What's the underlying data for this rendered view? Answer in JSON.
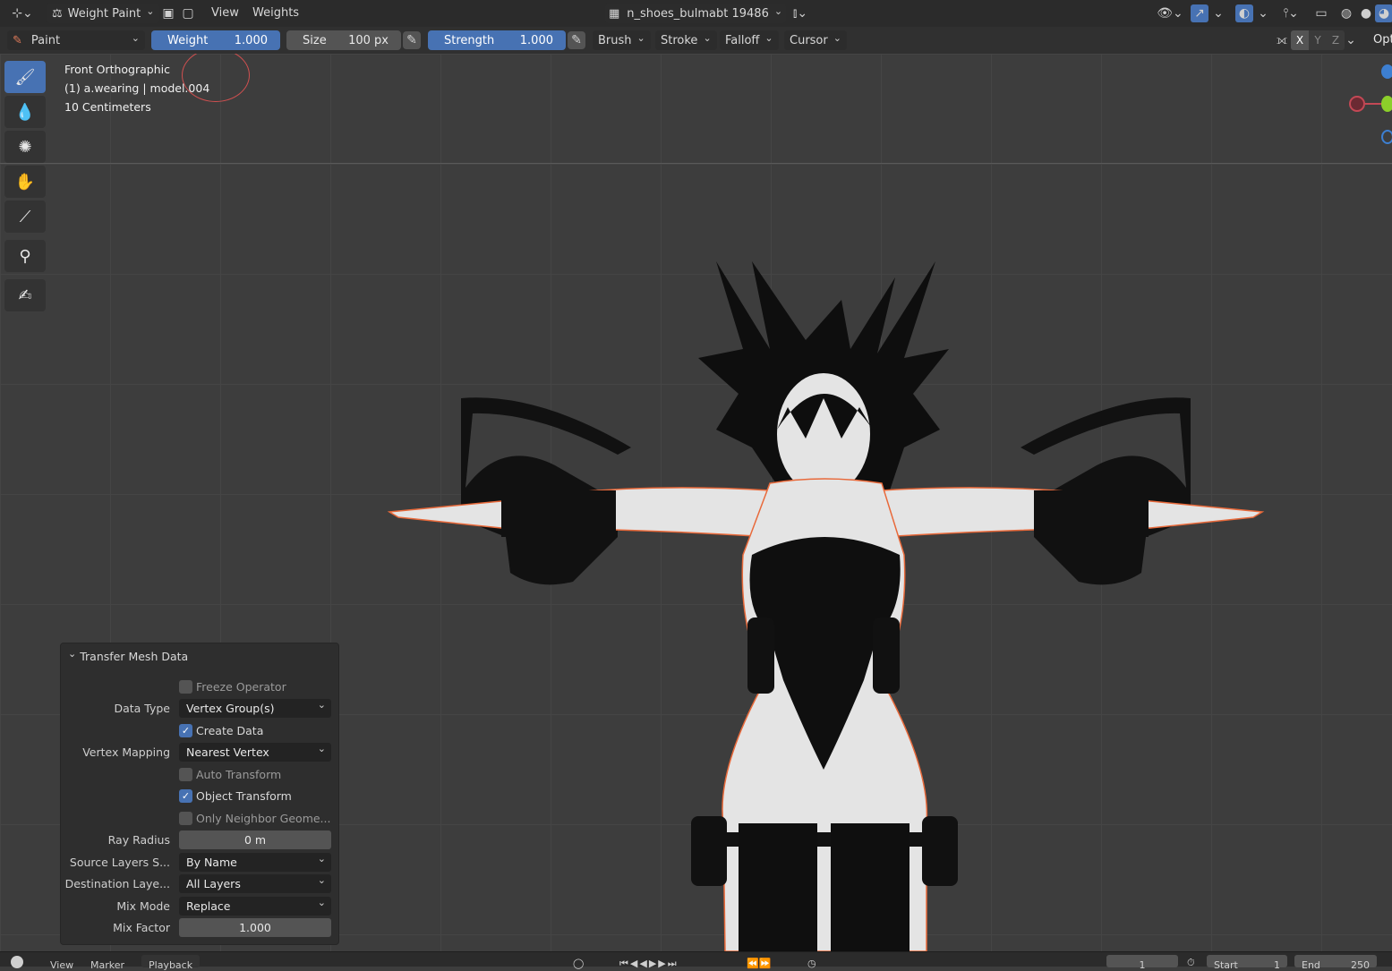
{
  "header": {
    "mode_label": "Weight Paint",
    "menu_view": "View",
    "menu_weights": "Weights",
    "vertex_group": "n_shoes_bulmabt 19486"
  },
  "tool_header": {
    "brush_name": "Paint",
    "weight_label": "Weight",
    "weight_value": "1.000",
    "size_label": "Size",
    "size_value": "100 px",
    "strength_label": "Strength",
    "strength_value": "1.000",
    "brush_menu": "Brush",
    "stroke_menu": "Stroke",
    "falloff_menu": "Falloff",
    "cursor_menu": "Cursor",
    "mirror_x": "X",
    "mirror_y": "Y",
    "mirror_z": "Z",
    "options_label": "Opt"
  },
  "viewport": {
    "view_name": "Front Orthographic",
    "object_info": "(1) a.wearing | model.004",
    "scale_info": "10 Centimeters"
  },
  "panel": {
    "title": "Transfer Mesh Data",
    "freeze_operator": "Freeze Operator",
    "data_type_label": "Data Type",
    "data_type_value": "Vertex Group(s)",
    "create_data": "Create Data",
    "vertex_mapping_label": "Vertex Mapping",
    "vertex_mapping_value": "Nearest Vertex",
    "auto_transform": "Auto Transform",
    "object_transform": "Object Transform",
    "only_neighbor": "Only Neighbor Geome...",
    "ray_radius_label": "Ray Radius",
    "ray_radius_value": "0 m",
    "source_layers_label": "Source Layers S...",
    "source_layers_value": "By Name",
    "dest_layers_label": "Destination Laye...",
    "dest_layers_value": "All Layers",
    "mix_mode_label": "Mix Mode",
    "mix_mode_value": "Replace",
    "mix_factor_label": "Mix Factor",
    "mix_factor_value": "1.000"
  },
  "timeline": {
    "view": "View",
    "marker": "Marker",
    "playback": "Playback",
    "frame": "1",
    "start_label": "Start",
    "start_value": "1",
    "end_label": "End",
    "end_value": "250"
  },
  "colors": {
    "accent_blue": "#4772b3",
    "selection_outline": "#e8693a"
  },
  "checkboxes": {
    "freeze_operator": false,
    "create_data": true,
    "auto_transform": false,
    "object_transform": true,
    "only_neighbor": false
  }
}
